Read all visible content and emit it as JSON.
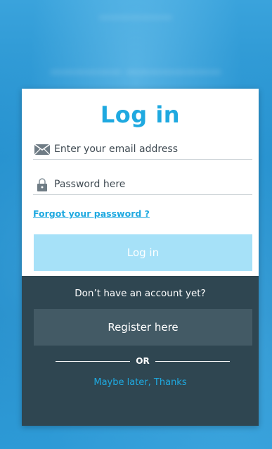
{
  "title": "Log in",
  "email_field": {
    "placeholder": "Enter your email address",
    "value": "",
    "icon": "envelope-icon"
  },
  "password_field": {
    "placeholder": "Password here",
    "value": "",
    "icon": "lock-icon"
  },
  "forgot_link": "Forgot your password ?",
  "login_button": "Log in",
  "no_account_text": "Don’t have an account yet?",
  "register_button": "Register here",
  "or_text": "OR",
  "maybe_later_link": "Maybe later, Thanks",
  "colors": {
    "accent": "#1fa9e0",
    "login_button_bg": "#a6e1f8",
    "bottom_panel_bg": "#2f4651",
    "register_button_bg": "#435a65",
    "background": "#1f86c6"
  }
}
